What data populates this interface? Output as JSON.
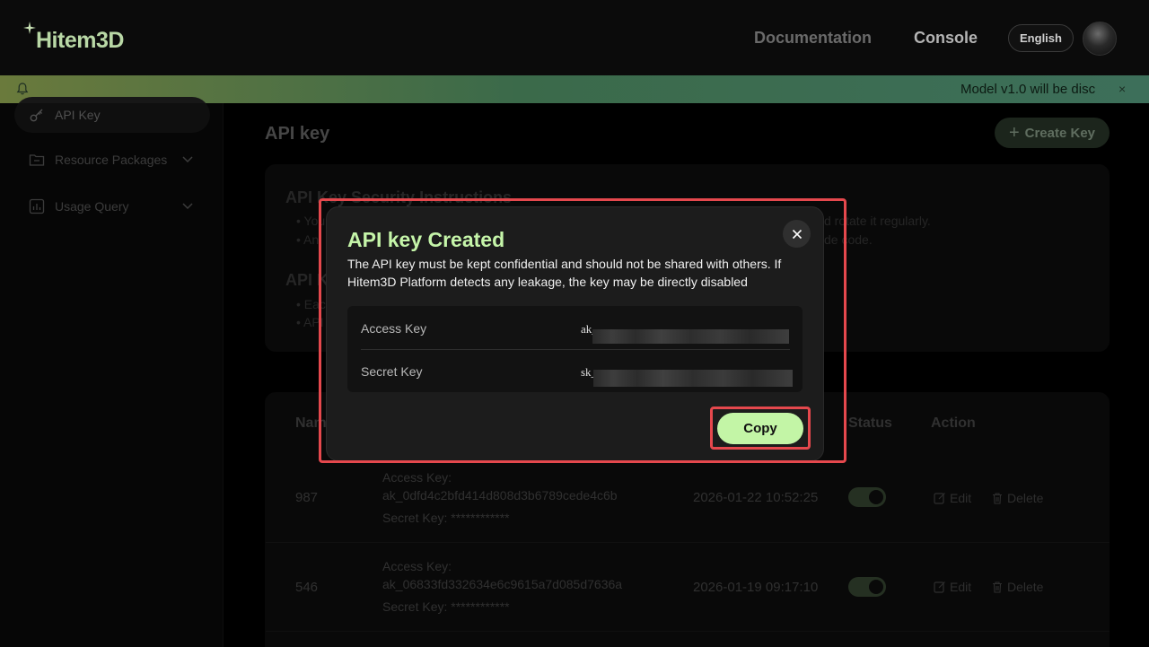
{
  "header": {
    "logo_text": "Hitem3D",
    "nav": {
      "documentation": "Documentation",
      "console": "Console"
    },
    "language": "English"
  },
  "announcement": {
    "text": "Model v1.0 will be disc",
    "close": "×"
  },
  "sidebar": {
    "items": [
      {
        "label": "API Key",
        "icon": "key-icon",
        "active": true
      },
      {
        "label": "Resource Packages",
        "icon": "folder-icon",
        "expandable": true
      },
      {
        "label": "Usage Query",
        "icon": "chart-icon",
        "expandable": true
      }
    ]
  },
  "main": {
    "title": "API key",
    "create_button": "Create Key",
    "security": {
      "heading1": "API Key Security Instructions",
      "line1_start": "• You",
      "line1_end": "d rotate it regularly.",
      "line2_start": "• An",
      "line2_end": "de code.",
      "heading2": "API K",
      "line3_start": "• Eac",
      "line4_start": "• API"
    },
    "table": {
      "headers": {
        "name": "Nam",
        "status": "Status",
        "action": "Action"
      },
      "rows": [
        {
          "name": "987",
          "access_label": "Access Key:",
          "access_value": "ak_0dfd4c2bfd414d808d3b6789cede4c6b",
          "secret": "Secret Key: ************",
          "created": "2026-01-22 10:52:25",
          "edit": "Edit",
          "delete": "Delete"
        },
        {
          "name": "546",
          "access_label": "Access Key:",
          "access_value": "ak_06833fd332634e6c9615a7d085d7636a",
          "secret": "Secret Key: ************",
          "created": "2026-01-19 09:17:10",
          "edit": "Edit",
          "delete": "Delete"
        }
      ]
    }
  },
  "modal": {
    "title": "API key Created",
    "description": "The API key must be kept confidential and should not be shared with others. If Hitem3D Platform detects any leakage, the key may be directly disabled",
    "access_label": "Access Key",
    "access_prefix": "ak_",
    "secret_label": "Secret Key",
    "secret_prefix": "sk_",
    "copy_button": "Copy"
  },
  "colors": {
    "accent": "#c3f5a6",
    "highlight": "#e5484d"
  }
}
